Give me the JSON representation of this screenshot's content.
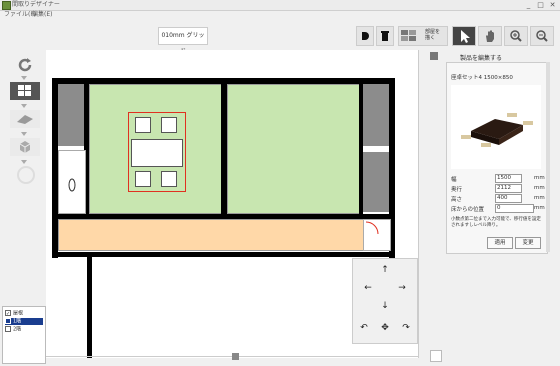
{
  "app": {
    "title": "間取りデザイナー"
  },
  "window_buttons": [
    "_",
    "□",
    "✕"
  ],
  "menu": [
    "ファイル(F)",
    "編集(E)"
  ],
  "toolbar": {
    "grid_button": "010mm グリッド",
    "room_button": "部屋を\n描く"
  },
  "panel": {
    "header": "製品を編集する",
    "product_title": "座卓セット4 1500×850",
    "fields": [
      {
        "label": "幅",
        "value": "1500",
        "unit": "mm"
      },
      {
        "label": "奥行",
        "value": "2112",
        "unit": "mm"
      },
      {
        "label": "高さ",
        "value": "400",
        "unit": "mm"
      },
      {
        "label": "床からの位置",
        "value": "0",
        "unit": "mm"
      }
    ],
    "note": "小数点第二位まで入力可能で、移行値を設定されますしレベル降り。",
    "apply_label": "適用",
    "change_label": "変更"
  },
  "layers": [
    {
      "label": "屋根",
      "checked": true
    },
    {
      "label": "1階",
      "checked": true,
      "selected": true
    },
    {
      "label": "2階",
      "checked": false
    }
  ],
  "navpad": {
    "up": "↑",
    "down": "↓",
    "left": "←",
    "right": "→",
    "rotate_left": "↶",
    "rotate_right": "↷",
    "center": "✥"
  }
}
